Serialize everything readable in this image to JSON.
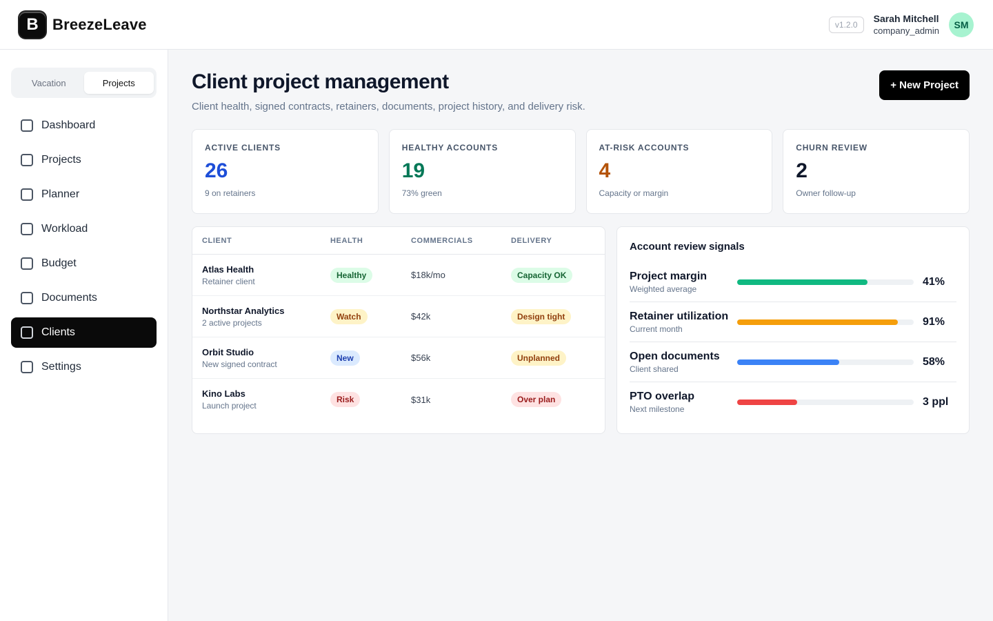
{
  "app": {
    "logo_letter": "B",
    "name": "BreezeLeave",
    "version": "v1.2.0"
  },
  "user": {
    "name": "Sarah Mitchell",
    "role": "company_admin",
    "initials": "SM"
  },
  "mode_switch": {
    "items": [
      {
        "label": "Vacation",
        "active": false
      },
      {
        "label": "Projects",
        "active": true
      }
    ]
  },
  "nav": {
    "items": [
      {
        "label": "Dashboard"
      },
      {
        "label": "Projects"
      },
      {
        "label": "Planner"
      },
      {
        "label": "Workload"
      },
      {
        "label": "Budget"
      },
      {
        "label": "Documents"
      },
      {
        "label": "Clients",
        "active": true
      },
      {
        "label": "Settings"
      }
    ]
  },
  "page": {
    "title": "Client project management",
    "subtitle": "Client health, signed contracts, retainers, documents, project history, and delivery risk.",
    "new_button": "+ New Project"
  },
  "stats": [
    {
      "label": "ACTIVE CLIENTS",
      "value": "26",
      "note": "9 on retainers",
      "color": "#1d4ed8"
    },
    {
      "label": "HEALTHY ACCOUNTS",
      "value": "19",
      "note": "73% green",
      "color": "#047857"
    },
    {
      "label": "AT-RISK ACCOUNTS",
      "value": "4",
      "note": "Capacity or margin",
      "color": "#b45309"
    },
    {
      "label": "CHURN REVIEW",
      "value": "2",
      "note": "Owner follow-up",
      "color": "#0f172a"
    }
  ],
  "clients_table": {
    "headers": [
      "CLIENT",
      "HEALTH",
      "COMMERCIALS",
      "DELIVERY"
    ],
    "rows": [
      {
        "name": "Atlas Health",
        "sub": "Retainer client",
        "health": "Healthy",
        "commercials": "$18k/mo",
        "delivery": "Capacity OK"
      },
      {
        "name": "Northstar Analytics",
        "sub": "2 active projects",
        "health": "Watch",
        "commercials": "$42k",
        "delivery": "Design tight"
      },
      {
        "name": "Orbit Studio",
        "sub": "New signed contract",
        "health": "New",
        "commercials": "$56k",
        "delivery": "Unplanned"
      },
      {
        "name": "Kino Labs",
        "sub": "Launch project",
        "health": "Risk",
        "commercials": "$31k",
        "delivery": "Over plan"
      }
    ]
  },
  "pill_colors": {
    "green": {
      "bg": "#dcfce7",
      "fg": "#166534"
    },
    "yellow": {
      "bg": "#fef3c7",
      "fg": "#92400e"
    },
    "blue": {
      "bg": "#dbeafe",
      "fg": "#1e40af"
    },
    "red": {
      "bg": "#fee2e2",
      "fg": "#991b1b"
    }
  },
  "signals": {
    "title": "Account review signals",
    "items": [
      {
        "label": "Project margin",
        "sub": "Weighted average",
        "value": "41%",
        "level": 0.74,
        "color": "#10b981"
      },
      {
        "label": "Retainer utilization",
        "sub": "Current month",
        "value": "91%",
        "level": 0.91,
        "color": "#f59e0b"
      },
      {
        "label": "Open documents",
        "sub": "Client shared",
        "value": "58%",
        "level": 0.58,
        "color": "#3b82f6"
      },
      {
        "label": "PTO overlap",
        "sub": "Next milestone",
        "value": "3 ppl",
        "level": 0.34,
        "color": "#ef4444"
      }
    ]
  }
}
